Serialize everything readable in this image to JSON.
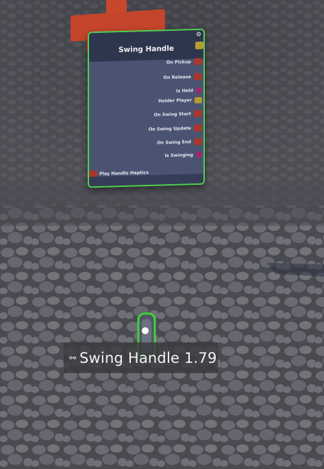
{
  "node": {
    "title": "Swing Handle",
    "gear_icon": "gear-icon",
    "outputs": [
      {
        "label": "On Pickup",
        "kind": "trigger"
      },
      {
        "label": "On Release",
        "kind": "trigger"
      },
      {
        "label": "Is Held",
        "kind": "bool"
      },
      {
        "label": "Holder Player",
        "kind": "obj"
      },
      {
        "label": "On Swing Start",
        "kind": "trigger"
      },
      {
        "label": "On Swing Update",
        "kind": "trigger"
      },
      {
        "label": "On Swing End",
        "kind": "trigger"
      },
      {
        "label": "Is Swinging",
        "kind": "bool"
      }
    ],
    "input": {
      "label": "Play Handle Haptics"
    }
  },
  "handle": {
    "label": "Swing Handle 1.79",
    "icon": "link-icon"
  },
  "colors": {
    "selection": "#4fd24f",
    "panel": "#4b5373",
    "panel_header": "#2e364d",
    "trigger_port": "#a8382f",
    "bool_port": "#9a2a6c",
    "object_port": "#b89a33",
    "post": "#c9472a",
    "ground": "#55555c"
  }
}
